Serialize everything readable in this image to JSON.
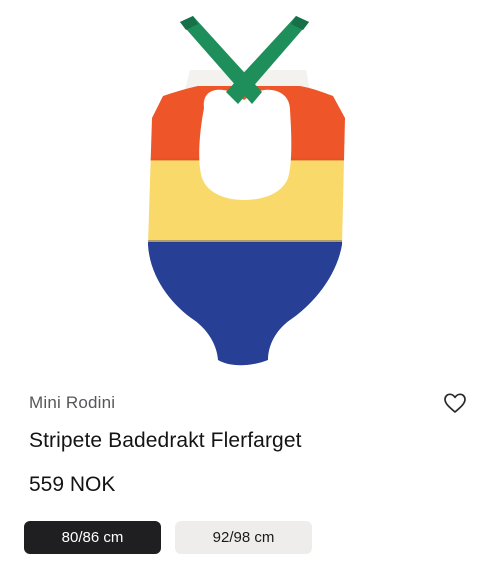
{
  "product": {
    "brand": "Mini Rodini",
    "name": "Stripete Badedrakt Flerfarget",
    "price": "559 NOK",
    "image_alt": "Striped swimsuit, back view",
    "colors": {
      "strap": "#1e8e5a",
      "orange": "#ee5528",
      "yellow": "#f8d96a",
      "blue": "#273f95"
    }
  },
  "sizes": [
    {
      "label": "80/86 cm",
      "selected": true
    },
    {
      "label": "92/98 cm",
      "selected": false
    }
  ],
  "icons": {
    "wishlist": "heart-outline-icon"
  }
}
